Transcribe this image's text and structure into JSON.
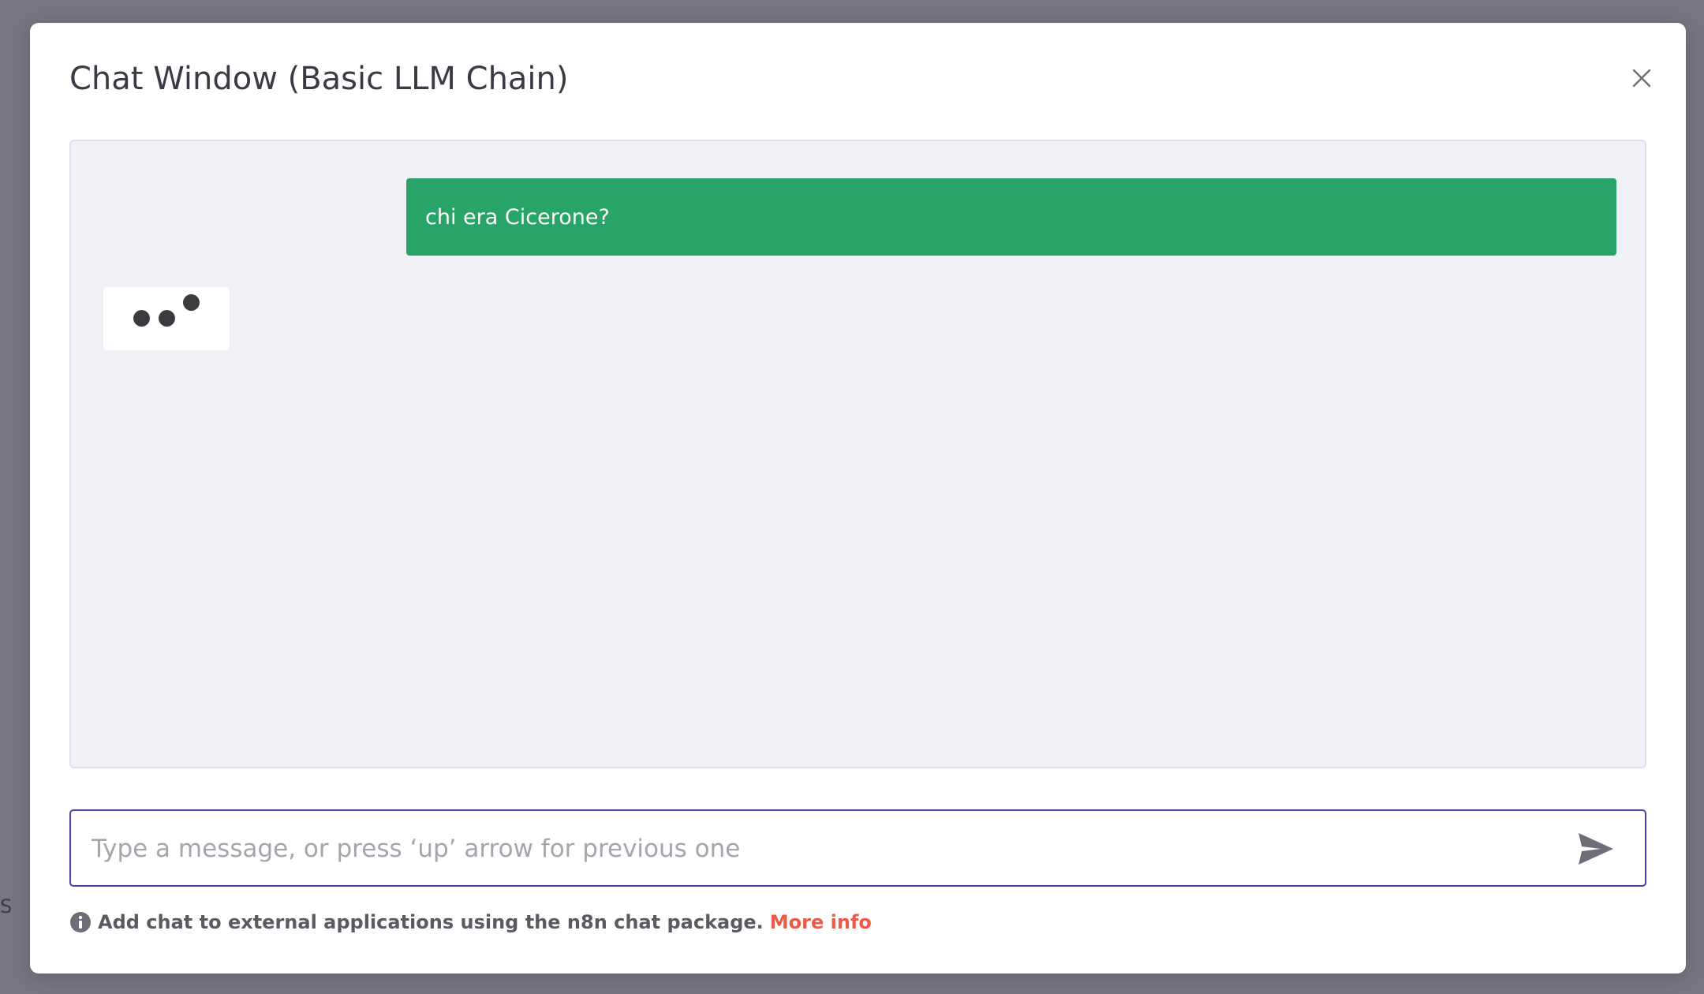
{
  "background": {
    "partial_text": "S"
  },
  "modal": {
    "title": "Chat Window (Basic LLM Chain)",
    "close_icon": "close-icon"
  },
  "messages": [
    {
      "role": "user",
      "text": "chi era Cicerone?",
      "color": "#29a468"
    },
    {
      "role": "bot",
      "status": "typing",
      "icon": "typing-dots-icon"
    }
  ],
  "input": {
    "placeholder": "Type a message, or press ‘up’ arrow for previous one",
    "value": "",
    "send_icon": "send-icon"
  },
  "footer": {
    "info_icon": "info-icon",
    "text": "Add chat to external applications using the n8n chat package.",
    "link_text": "More info"
  },
  "colors": {
    "accent": "#4b3fb0",
    "user_bubble": "#29a468",
    "link": "#ee5a48",
    "overlay": "#777580"
  }
}
